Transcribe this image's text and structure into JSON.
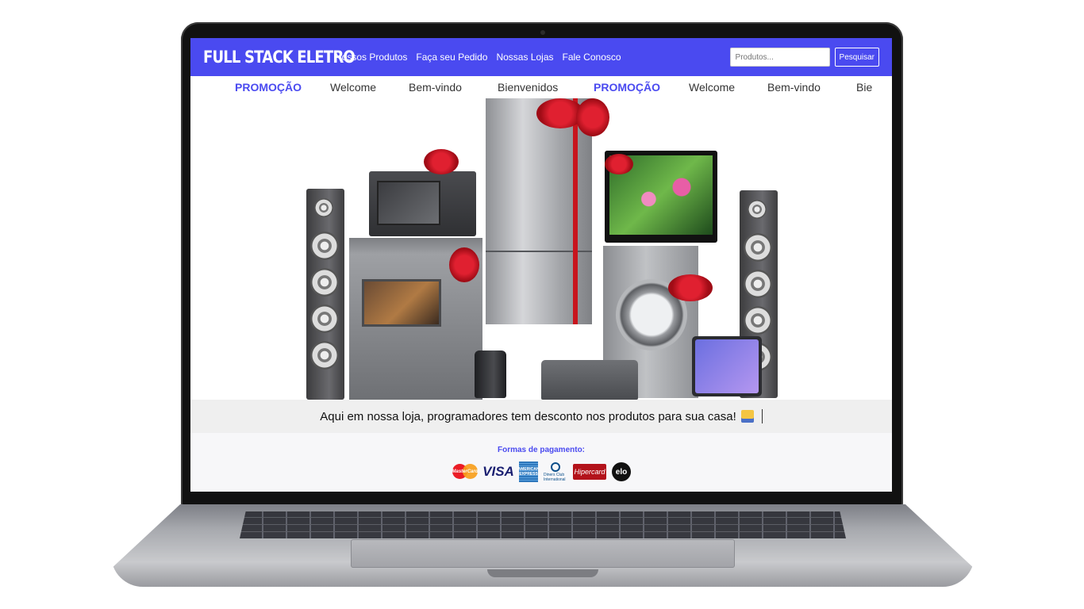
{
  "site": {
    "logo": "FULL STACK ELETRO",
    "nav": [
      "Nossos Produtos",
      "Faça seu Pedido",
      "Nossas Lojas",
      "Fale Conosco"
    ],
    "search": {
      "placeholder": "Produtos...",
      "button_label": "Pesquisar"
    },
    "accent_color": "#4a4af0"
  },
  "marquee": {
    "items": [
      "PROMOÇÃO",
      "Welcome",
      "Bem-vindo",
      "Bienvenidos",
      "PROMOÇÃO",
      "Welcome",
      "Bem-vindo",
      "Bie"
    ]
  },
  "hero": {
    "image_content": "home appliances with red gift ribbons"
  },
  "tagline": {
    "text": "Aqui em nossa loja, programadores tem desconto nos produtos para sua casa!"
  },
  "footer": {
    "payment_title": "Formas de pagamento:",
    "cards": [
      {
        "name": "mastercard-icon",
        "label": "MasterCard"
      },
      {
        "name": "visa-icon",
        "label": "VISA"
      },
      {
        "name": "amex-icon",
        "label": "AMERICAN EXPRESS"
      },
      {
        "name": "diners-icon",
        "label": "Diners Club International"
      },
      {
        "name": "hipercard-icon",
        "label": "Hipercard"
      },
      {
        "name": "elo-icon",
        "label": "elo"
      }
    ]
  }
}
